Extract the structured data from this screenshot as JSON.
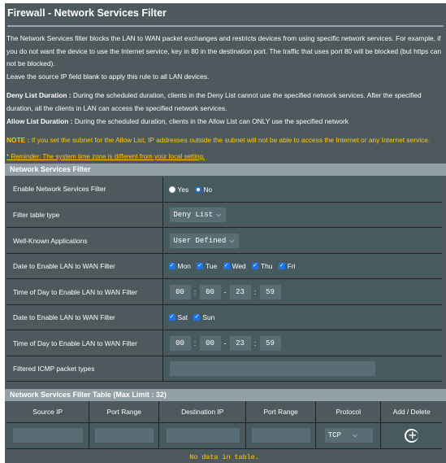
{
  "title": "Firewall - Network Services Filter",
  "description": {
    "para1": "The Network Services filter blocks the LAN to WAN packet exchanges and restricts devices from using specific network services. For example, if you do not want the device to use the Internet service, key in 80 in the destination port. The traffic that uses port 80 will be blocked (but https can not be blocked).",
    "para2": "Leave the source IP field blank to apply this rule to all LAN devices.",
    "deny_label": "Deny List Duration :",
    "deny_text": " During the scheduled duration, clients in the Deny List cannot use the specified network services. After the specified duration, all the clients in LAN can access the specified network services.",
    "allow_label": "Allow List Duration :",
    "allow_text": " During the scheduled duration, clients in the Allow List can ONLY use the specified network",
    "note_label": "NOTE :",
    "note_text": " If you set the subnet for the Allow List, IP addresses outside the subnet will not be able to access the Internet or any Internet service."
  },
  "reminder": "* Reminder: The system time zone is different from your local setting.",
  "filter_section": {
    "header": "Network Services Filter",
    "enable_label": "Enable Network Services Filter",
    "yes_label": "Yes",
    "no_label": "No",
    "enabled": false,
    "filter_type_label": "Filter table type",
    "filter_type_value": "Deny List",
    "well_known_label": "Well-Known Applications",
    "well_known_value": "User Defined",
    "weekday_label": "Date to Enable LAN to WAN Filter",
    "weekday_mon": "Mon",
    "weekday_tue": "Tue",
    "weekday_wed": "Wed",
    "weekday_thu": "Thu",
    "weekday_fri": "Fri",
    "weekday_time_label": "Time of Day to Enable LAN to WAN Filter",
    "weekday_start_h": "00",
    "weekday_start_m": "00",
    "weekday_end_h": "23",
    "weekday_end_m": "59",
    "weekend_label": "Date to Enable LAN to WAN Filter",
    "weekend_sat": "Sat",
    "weekend_sun": "Sun",
    "weekend_time_label": "Time of Day to Enable LAN to WAN Filter",
    "weekend_start_h": "00",
    "weekend_start_m": "00",
    "weekend_end_h": "23",
    "weekend_end_m": "59",
    "icmp_label": "Filtered ICMP packet types",
    "icmp_value": ""
  },
  "table_section": {
    "header": "Network Services Filter Table (Max Limit : 32)",
    "col_source_ip": "Source IP",
    "col_port_range_1": "Port Range",
    "col_destination_ip": "Destination IP",
    "col_port_range_2": "Port Range",
    "col_protocol": "Protocol",
    "col_add_delete": "Add / Delete",
    "protocol_value": "TCP",
    "no_data": "No data in table."
  },
  "colors": {
    "panel_bg": "#4d595d",
    "header_bar": "#92a0a5",
    "accent_blue": "#1976f0",
    "warning_yellow": "#ffcc00"
  },
  "icons": {
    "dropdown": "chevron-down-icon",
    "add": "plus-circle-icon",
    "checkbox": "checkmark-icon"
  }
}
